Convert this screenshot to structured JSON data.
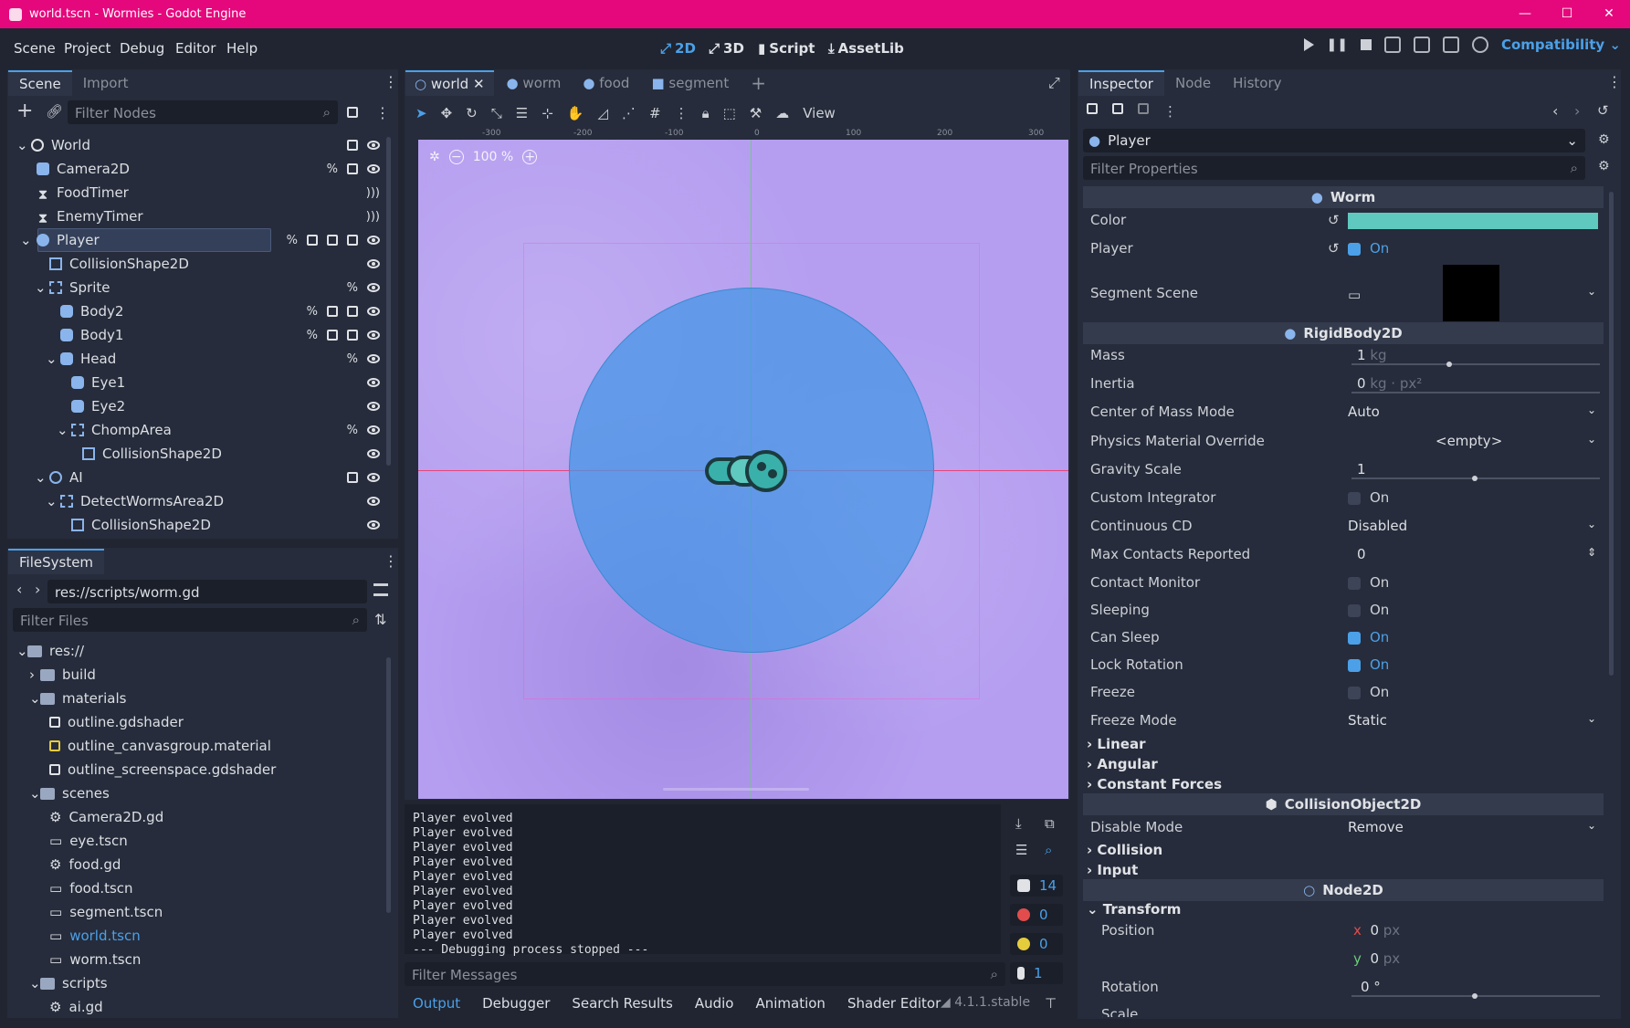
{
  "window": {
    "title": "world.tscn - Wormies - Godot Engine",
    "minimize": "—",
    "maximize": "☐",
    "close": "✕"
  },
  "menu": [
    "Scene",
    "Project",
    "Debug",
    "Editor",
    "Help"
  ],
  "modes": {
    "m2d": "2D",
    "m3d": "3D",
    "script": "Script",
    "assetlib": "AssetLib"
  },
  "renderer": "Compatibility",
  "scene_panel": {
    "tabs": [
      "Scene",
      "Import"
    ],
    "filter_placeholder": "Filter Nodes",
    "nodes": [
      {
        "label": "World"
      },
      {
        "label": "Camera2D"
      },
      {
        "label": "FoodTimer"
      },
      {
        "label": "EnemyTimer"
      },
      {
        "label": "Player"
      },
      {
        "label": "CollisionShape2D"
      },
      {
        "label": "Sprite"
      },
      {
        "label": "Body2"
      },
      {
        "label": "Body1"
      },
      {
        "label": "Head"
      },
      {
        "label": "Eye1"
      },
      {
        "label": "Eye2"
      },
      {
        "label": "ChompArea"
      },
      {
        "label": "CollisionShape2D"
      },
      {
        "label": "AI"
      },
      {
        "label": "DetectWormsArea2D"
      },
      {
        "label": "CollisionShape2D"
      }
    ]
  },
  "filesystem": {
    "tab": "FileSystem",
    "path": "res://scripts/worm.gd",
    "filter_placeholder": "Filter Files",
    "items": [
      {
        "label": "res://"
      },
      {
        "label": "build"
      },
      {
        "label": "materials"
      },
      {
        "label": "outline.gdshader"
      },
      {
        "label": "outline_canvasgroup.material"
      },
      {
        "label": "outline_screenspace.gdshader"
      },
      {
        "label": "scenes"
      },
      {
        "label": "Camera2D.gd"
      },
      {
        "label": "eye.tscn"
      },
      {
        "label": "food.gd"
      },
      {
        "label": "food.tscn"
      },
      {
        "label": "segment.tscn"
      },
      {
        "label": "world.tscn"
      },
      {
        "label": "worm.tscn"
      },
      {
        "label": "scripts"
      },
      {
        "label": "ai.gd"
      }
    ]
  },
  "editor_tabs": [
    "world",
    "worm",
    "food",
    "segment"
  ],
  "toolbar": {
    "view": "View",
    "zoom": "100 %"
  },
  "ruler_labels": [
    "-300",
    "-200",
    "-100",
    "0",
    "100",
    "200",
    "300"
  ],
  "output": {
    "lines": [
      "Player evolved",
      "Player evolved",
      "Player evolved",
      "Player evolved",
      "Player evolved",
      "Player evolved",
      "Player evolved",
      "Player evolved",
      "Player evolved",
      "--- Debugging process stopped ---"
    ],
    "filter_placeholder": "Filter Messages",
    "counts": {
      "messages": "14",
      "errors": "0",
      "warnings": "0",
      "info": "1"
    },
    "bottom_tabs": [
      "Output",
      "Debugger",
      "Search Results",
      "Audio",
      "Animation",
      "Shader Editor"
    ],
    "version": "4.1.1.stable"
  },
  "inspector": {
    "tabs": [
      "Inspector",
      "Node",
      "History"
    ],
    "object": "Player",
    "filter_placeholder": "Filter Properties",
    "worm_section": "Worm",
    "color_label": "Color",
    "color_value": "#5fc8bf",
    "player_label": "Player",
    "on": "On",
    "segment_label": "Segment Scene",
    "rigid_section": "RigidBody2D",
    "mass": {
      "label": "Mass",
      "value": "1",
      "unit": "kg"
    },
    "inertia": {
      "label": "Inertia",
      "value": "0",
      "unit": "kg · px²"
    },
    "com_mode": {
      "label": "Center of Mass Mode",
      "value": "Auto"
    },
    "phys_mat": {
      "label": "Physics Material Override",
      "value": "<empty>"
    },
    "gravity": {
      "label": "Gravity Scale",
      "value": "1"
    },
    "custom_integrator": {
      "label": "Custom Integrator"
    },
    "continuous_cd": {
      "label": "Continuous CD",
      "value": "Disabled"
    },
    "max_contacts": {
      "label": "Max Contacts Reported",
      "value": "0"
    },
    "contact_monitor": {
      "label": "Contact Monitor"
    },
    "sleeping": {
      "label": "Sleeping"
    },
    "can_sleep": {
      "label": "Can Sleep"
    },
    "lock_rotation": {
      "label": "Lock Rotation"
    },
    "freeze": {
      "label": "Freeze"
    },
    "freeze_mode": {
      "label": "Freeze Mode",
      "value": "Static"
    },
    "cats1": [
      "Linear",
      "Angular",
      "Constant Forces"
    ],
    "collision_section": "CollisionObject2D",
    "disable_mode": {
      "label": "Disable Mode",
      "value": "Remove"
    },
    "cats2": [
      "Collision",
      "Input"
    ],
    "node2d_section": "Node2D",
    "transform": "Transform",
    "position": {
      "label": "Position",
      "x": "0",
      "y": "0",
      "unit": "px",
      "xl": "x",
      "yl": "y"
    },
    "rotation": {
      "label": "Rotation",
      "value": "0 °"
    },
    "scale": {
      "label": "Scale"
    }
  }
}
